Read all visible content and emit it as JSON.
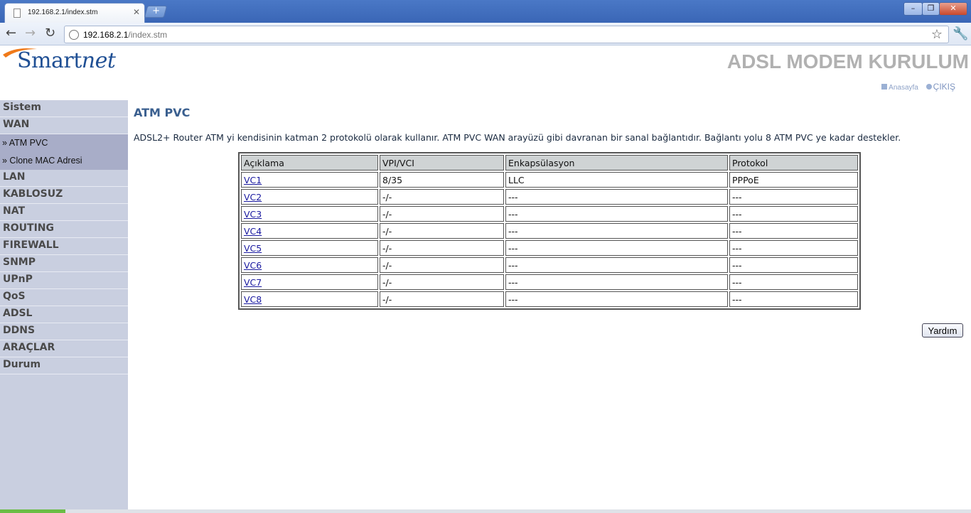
{
  "browser": {
    "tab_title": "192.168.2.1/index.stm",
    "new_tab": "+",
    "url_host": "192.168.2.1",
    "url_path": "/index.stm",
    "controls": {
      "minimize": "–",
      "maximize": "❐",
      "close": "✕"
    }
  },
  "header": {
    "logo_main": "Smart",
    "logo_suffix": "net",
    "title": "ADSL MODEM KURULUM",
    "home_link": "Anasayfa",
    "logout_link": "ÇIKIŞ"
  },
  "sidebar": {
    "items": [
      {
        "label": "Sistem"
      },
      {
        "label": "WAN"
      },
      {
        "label": "» ATM PVC"
      },
      {
        "label": "» Clone MAC Adresi"
      },
      {
        "label": "LAN"
      },
      {
        "label": "KABLOSUZ"
      },
      {
        "label": "NAT"
      },
      {
        "label": "ROUTING"
      },
      {
        "label": "FIREWALL"
      },
      {
        "label": "SNMP"
      },
      {
        "label": "UPnP"
      },
      {
        "label": "QoS"
      },
      {
        "label": "ADSL"
      },
      {
        "label": "DDNS"
      },
      {
        "label": "ARAÇLAR"
      },
      {
        "label": "Durum"
      }
    ]
  },
  "main": {
    "title": "ATM PVC",
    "description": "ADSL2+ Router ATM yi kendisinin katman 2 protokolü olarak kullanır. ATM PVC WAN arayüzü gibi davranan bir sanal bağlantıdır. Bağlantı yolu 8 ATM PVC ye kadar destekler.",
    "table": {
      "headers": [
        "Açıklama",
        "VPI/VCI",
        "Enkapsülasyon",
        "Protokol"
      ],
      "rows": [
        [
          "VC1",
          "8/35",
          "LLC",
          "PPPoE"
        ],
        [
          "VC2",
          "-/-",
          "---",
          "---"
        ],
        [
          "VC3",
          "-/-",
          "---",
          "---"
        ],
        [
          "VC4",
          "-/-",
          "---",
          "---"
        ],
        [
          "VC5",
          "-/-",
          "---",
          "---"
        ],
        [
          "VC6",
          "-/-",
          "---",
          "---"
        ],
        [
          "VC7",
          "-/-",
          "---",
          "---"
        ],
        [
          "VC8",
          "-/-",
          "---",
          "---"
        ]
      ]
    },
    "help_button": "Yardım"
  }
}
